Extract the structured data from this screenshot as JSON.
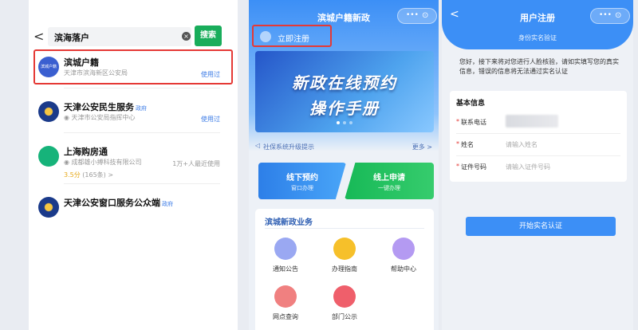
{
  "search": {
    "query": "滨海落户",
    "clear_icon": "×",
    "button": "搜索",
    "results": [
      {
        "name": "滨城户籍",
        "sub": "天津市滨海新区公安局",
        "tag": "使用过",
        "avatar_text": "滨城户籍"
      },
      {
        "name": "天津公安民生服务",
        "badge": "政府",
        "sub": "天津市公安局指挥中心",
        "tag": "使用过"
      },
      {
        "name": "上海购房通",
        "sub": "成都雄小搏科技有限公司",
        "tag": "1万+人最近使用",
        "rating": "3.5分",
        "rating_count": "(165条) >"
      },
      {
        "name": "天津公安窗口服务公众端",
        "badge": "政府"
      }
    ]
  },
  "home": {
    "title": "滨城户籍新政",
    "capsule_dots": "•••",
    "capsule_target": "⊙",
    "register": "立即注册",
    "banner_line1": "新政在线预约",
    "banner_line2": "操作手册",
    "notice": "社保系统升级提示",
    "notice_more": "更多 >",
    "offline_title": "线下预约",
    "offline_sub": "窗口办理",
    "online_title": "线上申请",
    "online_sub": "一键办理",
    "section_title": "滨城新政业务",
    "services": [
      "通知公告",
      "办理指南",
      "帮助中心",
      "网点查询",
      "部门公示"
    ]
  },
  "register": {
    "title": "用户注册",
    "subtitle": "身份实名验证",
    "intro": "您好，接下来将对您进行人脸核验，请如实填写您的真实信息，错误的信息将无法通过实名认证",
    "section": "基本信息",
    "phone_label": "联系电话",
    "name_label": "姓名",
    "name_placeholder": "请输入姓名",
    "id_label": "证件号码",
    "id_placeholder": "请输入证件号码",
    "required_mark": "*",
    "start_button": "开始实名认证"
  },
  "colors": {
    "primary_blue": "#3c8ff6",
    "green": "#19ad5b",
    "highlight_red": "#e53935"
  }
}
